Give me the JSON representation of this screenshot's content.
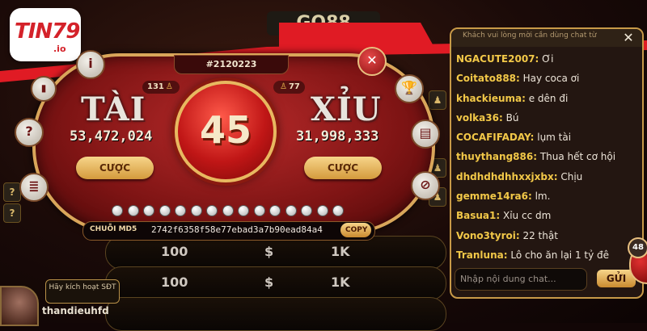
{
  "logo": {
    "text": "TIN79",
    "sub": ".io"
  },
  "background": {
    "top_title": "GO88",
    "rows": [
      {
        "amount": "100",
        "currency": "$",
        "chip": "1K"
      },
      {
        "amount": "100",
        "currency": "$",
        "chip": "1K"
      },
      {
        "amount": "",
        "currency": "",
        "chip": ""
      }
    ]
  },
  "game": {
    "session": "#2120223",
    "tai": {
      "label": "TÀI",
      "amount": "53,472,024",
      "players": "131",
      "bet_label": "CƯỢC"
    },
    "xiu": {
      "label": "XỈU",
      "amount": "31,998,333",
      "players": "77",
      "bet_label": "CƯỢC"
    },
    "timer": "45",
    "history_count": 15,
    "md5": {
      "label": "CHUỖI MD5",
      "value": "2742f6358f58e77ebad3a7b90ead84a4",
      "copy_label": "COPY"
    },
    "buttons": {
      "info": "i",
      "close": "✕",
      "help": "?",
      "chat": "▤"
    }
  },
  "player": {
    "activate_text": "Hãy kích hoạt SĐT",
    "username": "thandieuhfd"
  },
  "chat": {
    "header": "Khách vui lòng mời cần dùng chat từ",
    "messages": [
      {
        "user": "NGACUTE2007:",
        "text": " Ơi"
      },
      {
        "user": "Coitato888:",
        "text": " Hay coca ơi"
      },
      {
        "user": "khackieuma:",
        "text": " e dên đi"
      },
      {
        "user": "volka36:",
        "text": " Bú"
      },
      {
        "user": "COCAFIFADAY:",
        "text": " lụm tài"
      },
      {
        "user": "thuythang886:",
        "text": " Thua hết cơ hội"
      },
      {
        "user": "dhdhdhdhhxxjxbx:",
        "text": " Chịu"
      },
      {
        "user": "gemme14ra6:",
        "text": " lm."
      },
      {
        "user": "Basua1:",
        "text": " Xỉu cc dm"
      },
      {
        "user": "Vono3tyroi:",
        "text": " 22 thật"
      },
      {
        "user": "Tranluna:",
        "text": " Lô cho ăn lại 1 tỷ đê"
      }
    ],
    "placeholder": "Nhập nội dung chat...",
    "send_label": "GỬI",
    "close": "✕"
  },
  "badge": "48",
  "colors": {
    "gold": "#d9a65a",
    "panel_red": "#b82a2a",
    "stripe_red": "#e01b24",
    "chat_user": "#f2c848"
  }
}
